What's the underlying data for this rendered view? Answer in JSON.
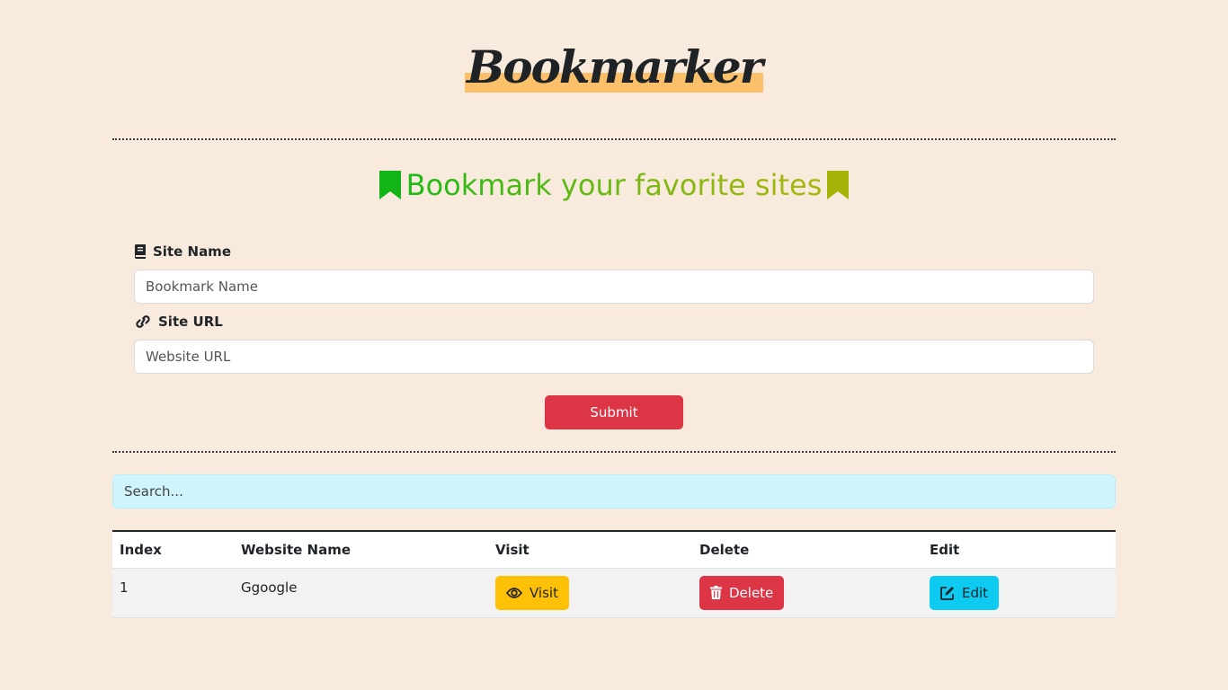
{
  "app": {
    "logo_text": "Bookmarker",
    "tagline": "Bookmark your favorite sites"
  },
  "form": {
    "site_name_label": "Site Name",
    "site_name_placeholder": "Bookmark Name",
    "site_name_value": "",
    "site_url_label": "Site URL",
    "site_url_placeholder": "Website URL",
    "site_url_value": "",
    "submit_label": "Submit"
  },
  "search": {
    "placeholder": "Search...",
    "value": ""
  },
  "table": {
    "headers": [
      "Index",
      "Website Name",
      "Visit",
      "Delete",
      "Edit"
    ],
    "rows": [
      {
        "index": "1",
        "name": "Ggoogle",
        "visit_label": "Visit",
        "delete_label": "Delete",
        "edit_label": "Edit"
      }
    ]
  },
  "icons": {
    "logo": "none",
    "tagline_left": "bookmark-icon",
    "tagline_right": "bookmark-icon",
    "site_name": "book-icon",
    "site_url": "link-icon",
    "visit": "eye-icon",
    "delete": "trash-icon",
    "edit": "edit-icon"
  },
  "colors": {
    "background": "#f8ebdd",
    "logo_highlight": "#fdc06a",
    "tagline_start": "#1dbb16",
    "tagline_end": "#a9b70c",
    "submit": "#dc3545",
    "search_bg": "#cff4fc",
    "visit": "#ffc107",
    "delete": "#dc3545",
    "edit": "#0dcaf0"
  }
}
